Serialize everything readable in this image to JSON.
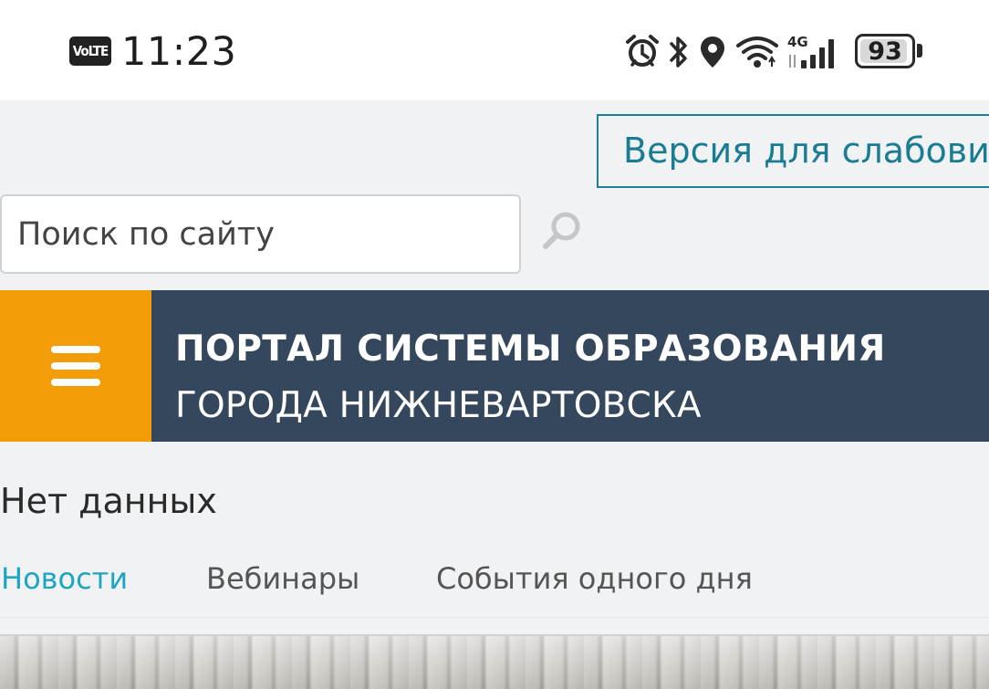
{
  "status_bar": {
    "volte": "VoLTE",
    "time": "11:23",
    "network": "4G",
    "battery": "93"
  },
  "header": {
    "accessibility_label": "Версия для слабовидящих",
    "search_placeholder": "Поиск по сайту"
  },
  "banner": {
    "title_line1": "ПОРТАЛ СИСТЕМЫ ОБРАЗОВАНИЯ",
    "title_line2": "ГОРОДА НИЖНЕВАРТОВСКА",
    "menu_icon": "hamburger-icon"
  },
  "main": {
    "no_data": "Нет данных",
    "tabs": [
      {
        "label": "Новости",
        "active": true
      },
      {
        "label": "Вебинары",
        "active": false
      },
      {
        "label": "События одного дня",
        "active": false
      }
    ]
  },
  "colors": {
    "accent": "#1fa5c1",
    "menu_orange": "#f29c07",
    "banner_navy": "#34475d",
    "button_border": "#1f7e95"
  }
}
